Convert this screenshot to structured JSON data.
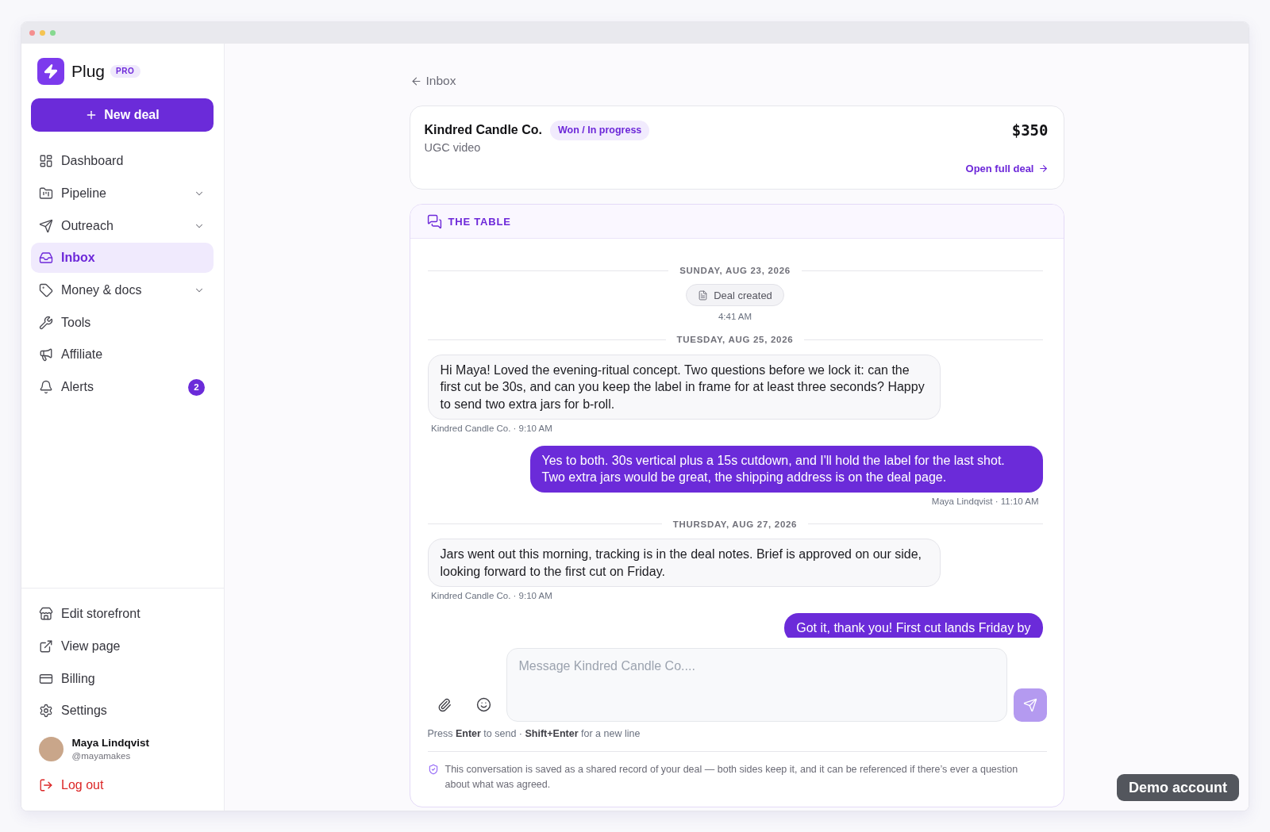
{
  "sidebar": {
    "brand": {
      "name": "Plug",
      "tier": "PRO"
    },
    "new_deal_button": "New deal",
    "nav": [
      {
        "label": "Dashboard",
        "kind": "link",
        "selected": false
      },
      {
        "label": "Pipeline",
        "kind": "group",
        "expanded": false,
        "selected": false
      },
      {
        "label": "Outreach",
        "kind": "group",
        "expanded": false,
        "selected": false
      },
      {
        "label": "Inbox",
        "kind": "link",
        "selected": true
      },
      {
        "label": "Money & docs",
        "kind": "group",
        "expanded": false,
        "selected": false
      },
      {
        "label": "Tools",
        "kind": "link",
        "selected": false
      },
      {
        "label": "Affiliate",
        "kind": "link",
        "selected": false
      },
      {
        "label": "Alerts",
        "kind": "link",
        "selected": false,
        "badge": "2"
      }
    ],
    "footer_nav": [
      {
        "label": "Edit storefront",
        "selected": false
      },
      {
        "label": "View page",
        "selected": false
      },
      {
        "label": "Billing",
        "selected": false
      },
      {
        "label": "Settings",
        "selected": false
      }
    ],
    "user": {
      "name": "Maya Lindqvist",
      "handle": "@mayamakes"
    },
    "logout": "Log out"
  },
  "back_link": "Inbox",
  "deal": {
    "company": "Kindred Candle Co.",
    "status": "Won / In progress",
    "type": "UGC video",
    "amount": "$350",
    "link": "Open full deal"
  },
  "thread": {
    "title": "THE TABLE",
    "items": [
      {
        "kind": "date",
        "text": "SUNDAY, AUG 23, 2026"
      },
      {
        "kind": "event",
        "text": "Deal created",
        "time": "4:41 AM"
      },
      {
        "kind": "date",
        "text": "TUESDAY, AUG 25, 2026"
      },
      {
        "kind": "received",
        "text": "Hi Maya! Loved the evening-ritual concept. Two questions before we lock it: can the first cut be 30s, and can you keep the label in frame for at least three seconds? Happy to send two extra jars for b-roll.",
        "meta": "Kindred Candle Co. · 9:10 AM"
      },
      {
        "kind": "sent",
        "text": "Yes to both. 30s vertical plus a 15s cutdown, and I'll hold the label for the last shot. Two extra jars would be great, the shipping address is on the deal page.",
        "meta": "Maya Lindqvist · 11:10 AM"
      },
      {
        "kind": "date",
        "text": "THURSDAY, AUG 27, 2026"
      },
      {
        "kind": "received",
        "text": "Jars went out this morning, tracking is in the deal notes. Brief is approved on our side, looking forward to the first cut on Friday.",
        "meta": "Kindred Candle Co. · 9:10 AM"
      },
      {
        "kind": "sent",
        "text": "Got it, thank you! First cut lands Friday by"
      }
    ]
  },
  "composer": {
    "placeholder": "Message Kindred Candle Co....",
    "send_disabled": true,
    "hint": "Press **Enter** to send · **Shift+Enter** for a new line"
  },
  "notice": "This conversation is saved as a shared record of your deal — both sides keep it, and it can be referenced if there’s ever a question about what was agreed.",
  "demo_badge": "Demo account"
}
